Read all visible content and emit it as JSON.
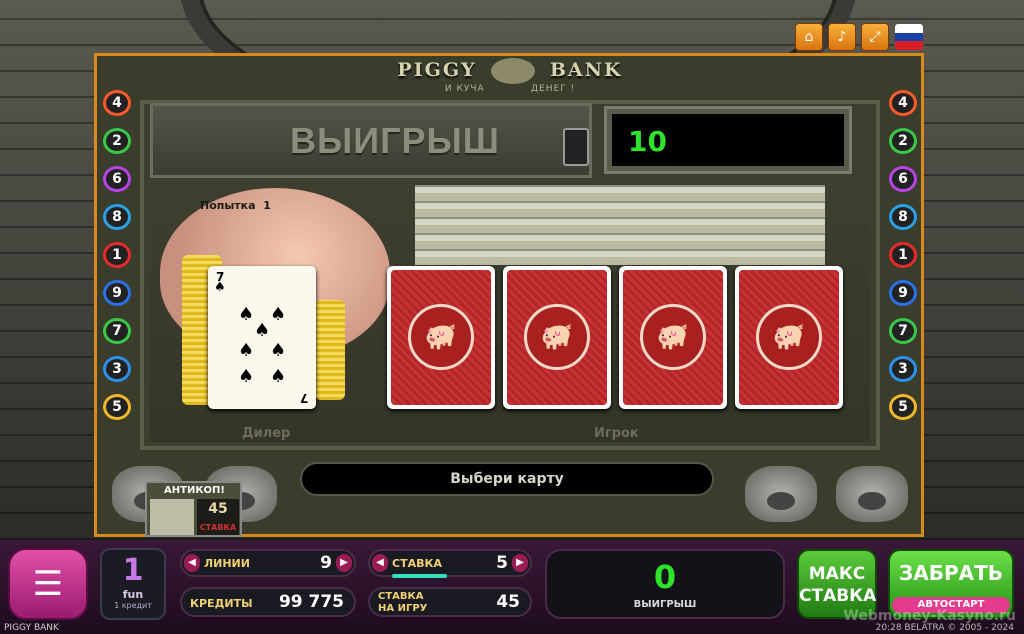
{
  "top_buttons": [
    "home-icon",
    "volume-icon",
    "fullscreen-icon"
  ],
  "flag_colors": [
    "#ffffff",
    "#1c3fa8",
    "#d41f24"
  ],
  "logo": {
    "title_left": "PIGGY",
    "title_right": "BANK",
    "subtitle_left": "И КУЧА",
    "subtitle_right": "ДЕНЕГ !"
  },
  "rail_numbers_left": [
    "4",
    "2",
    "6",
    "8",
    "1",
    "9",
    "7",
    "3",
    "5"
  ],
  "rail_numbers_right": [
    "4",
    "2",
    "6",
    "8",
    "1",
    "9",
    "7",
    "3",
    "5"
  ],
  "rail_colors": [
    "#ff5a2a",
    "#3ac84a",
    "#b844e8",
    "#2aa0e8",
    "#e82a2a",
    "#2a70e8",
    "#3ac84a",
    "#2a90e8",
    "#f0b82a"
  ],
  "game": {
    "win_label": "ВЫИГРЫШ",
    "win_value": "10",
    "attempt": "Попытка",
    "attempt_number": "1",
    "dealer_label": "Дилер",
    "player_label": "Игрок",
    "message": "Выбери карту",
    "dealer_card": {
      "rank": "7",
      "suit": "♠"
    },
    "player_cards": [
      "back",
      "back",
      "back",
      "back"
    ]
  },
  "anticop": {
    "title": "АНТИКОП!",
    "value": "45",
    "stake_label": "СТАВКА"
  },
  "bottom": {
    "menu_icon": "menu-icon",
    "fun_value": "1",
    "fun_label": "fun",
    "fun_sub": "1 кредит",
    "lines_label": "ЛИНИИ",
    "lines_value": "9",
    "stake_label": "СТАВКА",
    "stake_value": "5",
    "credits_label": "КРЕДИТЫ",
    "credits_value": "99 775",
    "game_stake_label_1": "СТАВКА",
    "game_stake_label_2": "НА ИГРУ",
    "game_stake_value": "45",
    "win_value": "0",
    "win_label": "ВЫИГРЫШ",
    "max_stake_1": "МАКС",
    "max_stake_2": "СТАВКА",
    "take": "ЗАБРАТЬ",
    "autostart": "АВТОСТАРТ",
    "arrow_left": "◀",
    "arrow_right": "▶"
  },
  "footer": {
    "game_name": "PIGGY BANK",
    "right": "20:28   BELATRA © 2005 - 2024",
    "watermark": "Webmoney-Kasyno.ru"
  }
}
